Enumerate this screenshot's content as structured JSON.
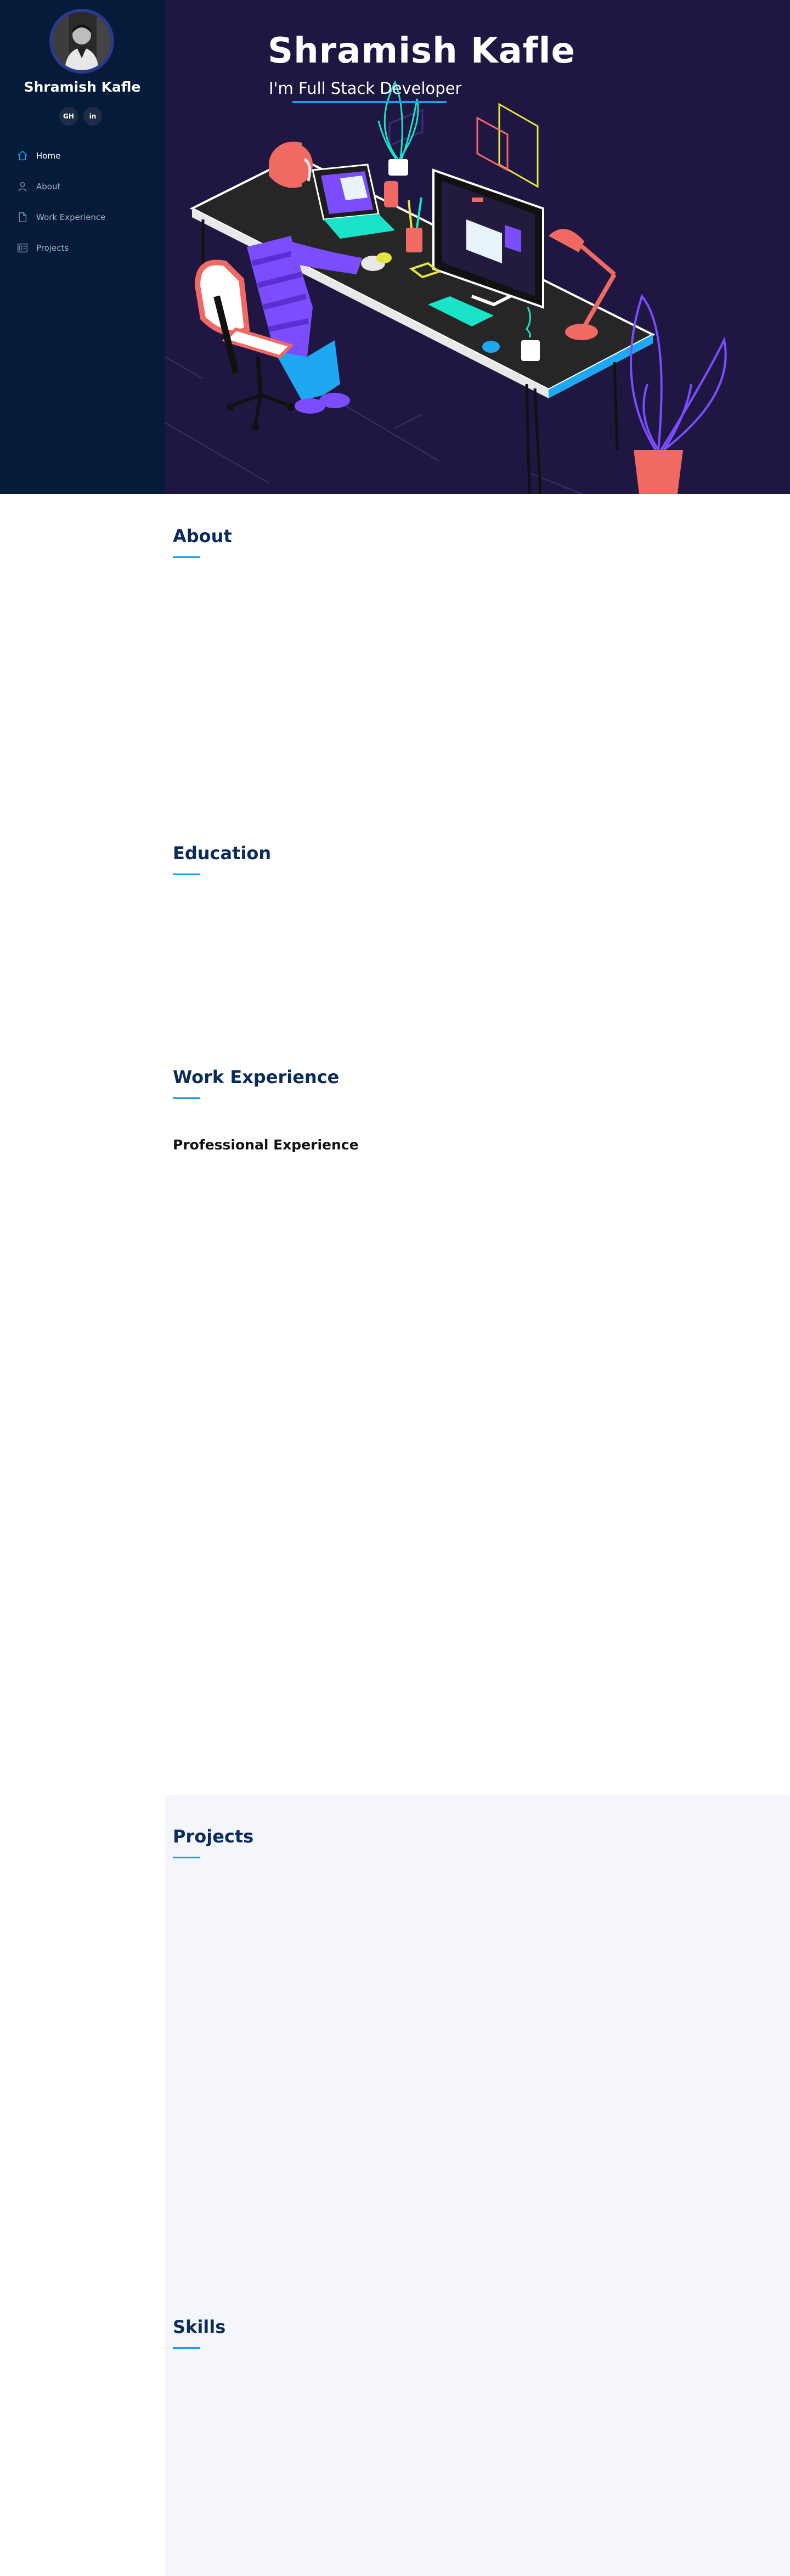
{
  "sidebar": {
    "name": "Shramish Kafle",
    "social": [
      {
        "label": "GH",
        "icon": "github-icon"
      },
      {
        "label": "in",
        "icon": "linkedin-icon"
      }
    ],
    "nav": [
      {
        "label": "Home",
        "icon": "home-icon",
        "active": true
      },
      {
        "label": "About",
        "icon": "person-icon",
        "active": false
      },
      {
        "label": "Work Experience",
        "icon": "file-icon",
        "active": false
      },
      {
        "label": "Projects",
        "icon": "projects-icon",
        "active": false
      }
    ]
  },
  "hero": {
    "title": "Shramish Kafle",
    "subtitle": "I'm Full Stack Developer"
  },
  "sections": {
    "about": "About",
    "education": "Education",
    "work": "Work Experience",
    "work_subtitle": "Professional Experience",
    "projects": "Projects",
    "skills": "Skills"
  },
  "colors": {
    "sidebar_bg": "#051b3a",
    "hero_bg": "#1f1741",
    "accent": "#1e9cf0",
    "heading": "#0b2b5c",
    "alt_section_bg": "#f4f6fc"
  }
}
